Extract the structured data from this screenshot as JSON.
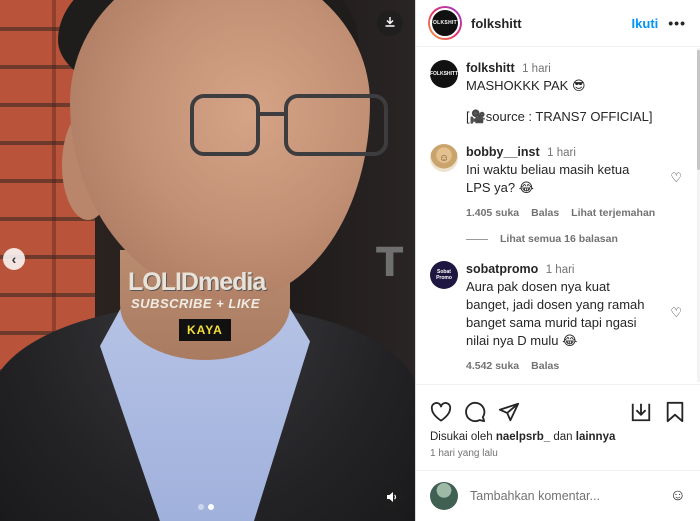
{
  "media": {
    "logo_text": "LOLIDmedia",
    "logo_sub": "SUBSCRIBE + LIKE",
    "caption_tag": "KAYA",
    "background_letter": "T"
  },
  "header": {
    "avatar_text": "FOLKSHITT",
    "username": "folkshitt",
    "follow_label": "Ikuti",
    "more_label": "•••"
  },
  "caption": {
    "avatar_text": "FOLKSHITT",
    "username": "folkshitt",
    "time": "1 hari",
    "text": "MASHOKKK PAK 😎",
    "source": "[🎥source : TRANS7 OFFICIAL]"
  },
  "comments": [
    {
      "username": "bobby__inst",
      "time": "1 hari",
      "text": "Ini waktu beliau masih ketua LPS ya? 😂",
      "likes": "1.405 suka",
      "reply_label": "Balas",
      "translate_label": "Lihat terjemahan",
      "view_replies": "Lihat semua 16 balasan"
    },
    {
      "username": "sobatpromo",
      "avatar_text": "Sobat Promo",
      "time": "1 hari",
      "text": "Aura pak dosen nya kuat banget, jadi dosen yang ramah banget sama murid tapi ngasi nilai nya D mulu 😂",
      "likes": "4.542 suka",
      "reply_label": "Balas"
    }
  ],
  "actions": {
    "liked_by_prefix": "Disukai oleh ",
    "liked_by_user": "naelpsrb_",
    "liked_by_and": " dan ",
    "liked_by_others": "lainnya",
    "time_ago": "1 hari yang lalu"
  },
  "compose": {
    "placeholder": "Tambahkan komentar..."
  },
  "icons": [
    "download-icon",
    "volume-icon",
    "chevron-left-icon",
    "heart-icon",
    "comment-icon",
    "share-icon",
    "save-to-collection-icon",
    "bookmark-icon",
    "emoji-icon"
  ]
}
